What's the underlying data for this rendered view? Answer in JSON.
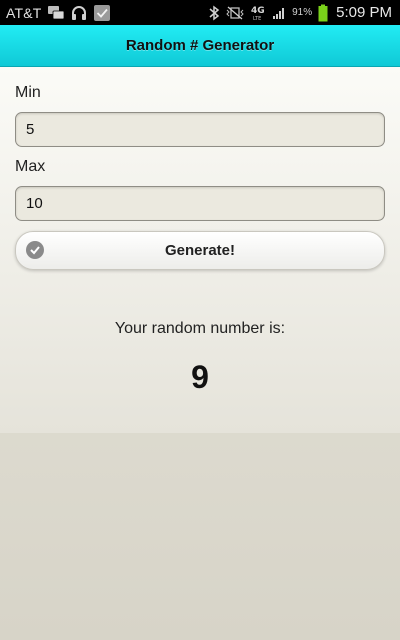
{
  "status_bar": {
    "carrier": "AT&T",
    "battery_percent": "91%",
    "time": "5:09 PM",
    "network_badge": "4G",
    "icons": [
      "messages-icon",
      "headphones-icon",
      "checkbox-icon",
      "bluetooth-icon",
      "no-vibrate-icon",
      "4g-lte-icon",
      "signal-icon",
      "battery-icon"
    ]
  },
  "header": {
    "title": "Random # Generator"
  },
  "form": {
    "min_label": "Min",
    "min_value": "5",
    "max_label": "Max",
    "max_value": "10",
    "generate_label": "Generate!"
  },
  "result": {
    "label": "Your random number is:",
    "value": "9"
  },
  "colors": {
    "header": "#18dbe4",
    "status_bar": "#000000",
    "battery": "#7ad21a"
  }
}
